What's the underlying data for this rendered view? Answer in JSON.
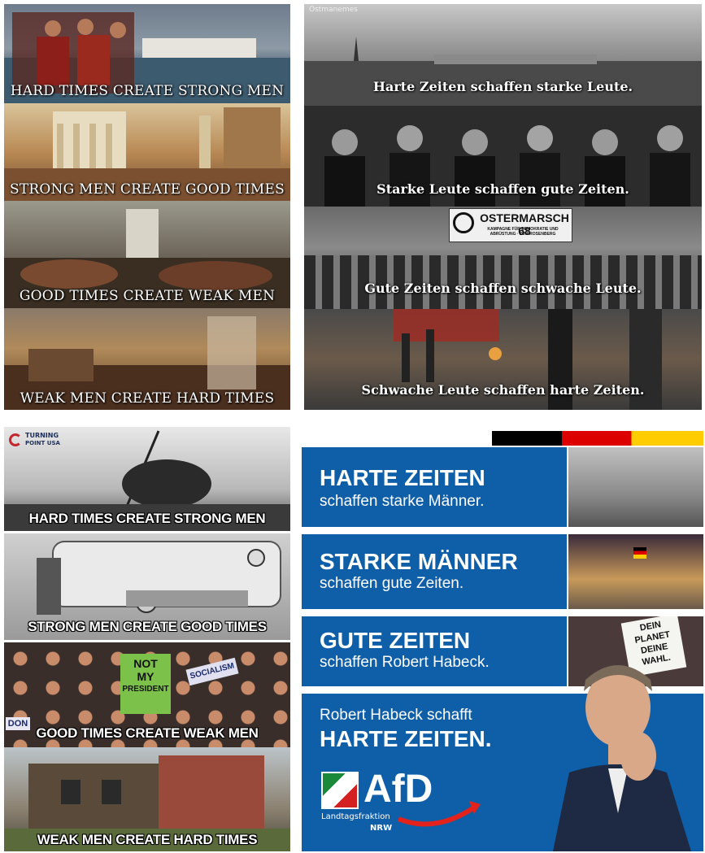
{
  "panels": {
    "classical": [
      "HARD TIMES CREATE STRONG MEN",
      "STRONG MEN CREATE GOOD TIMES",
      "GOOD TIMES CREATE WEAK MEN",
      "WEAK MEN CREATE HARD TIMES"
    ],
    "german_bw": [
      "Harte Zeiten schaffen starke Leute.",
      "Starke Leute schaffen gute Zeiten.",
      "Gute Zeiten schaffen schwache Leute.",
      "Schwache Leute schaffen harte Zeiten."
    ],
    "german_bw_watermark": "Ostmanemes",
    "protest_banner": "OSTERMARSCH 68",
    "protest_banner_small": "KAMPAGNE FÜR DEMOKRATIE UND ABRÜSTUNG · ZUM ROSENBERG",
    "american": [
      "HARD TIMES CREATE STRONG MEN",
      "STRONG MEN CREATE GOOD TIMES",
      "GOOD TIMES CREATE WEAK MEN",
      "WEAK MEN CREATE HARD TIMES"
    ],
    "tpusa_logo": {
      "line1": "TURNING",
      "line2": "POINT USA"
    },
    "protest_sign_1": [
      "NOT",
      "MY",
      "PRESIDENT"
    ],
    "protest_sign_2": "SOCIALISM",
    "protest_sign_3": "DON",
    "afd": {
      "blocks": [
        {
          "title": "HARTE ZEITEN",
          "subtitle": "schaffen starke Männer."
        },
        {
          "title": "STARKE MÄNNER",
          "subtitle": "schaffen gute Zeiten."
        },
        {
          "title": "GUTE ZEITEN",
          "subtitle": "schaffen Robert Habeck."
        },
        {
          "title": "HARTE ZEITEN.",
          "subtitle": "Robert Habeck schafft"
        }
      ],
      "logo": "AfD",
      "logo_sub1": "Landtagsfraktion",
      "logo_sub2": "NRW",
      "sign_text": [
        "DEIN",
        "PLANET",
        "DEINE",
        "WAHL."
      ]
    }
  }
}
